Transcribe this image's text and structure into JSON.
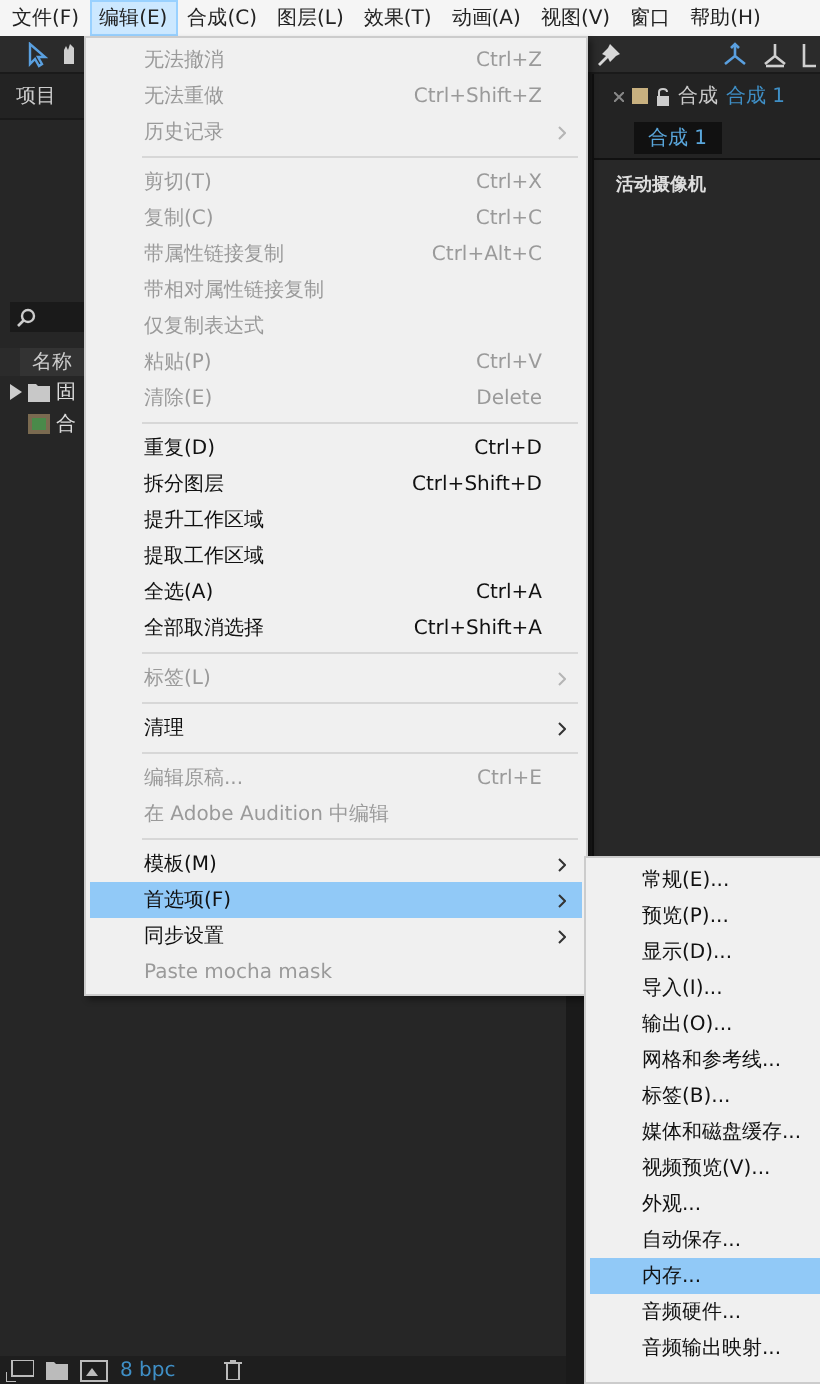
{
  "menubar": [
    {
      "label": "文件(F)",
      "selected": false
    },
    {
      "label": "编辑(E)",
      "selected": true
    },
    {
      "label": "合成(C)",
      "selected": false
    },
    {
      "label": "图层(L)",
      "selected": false
    },
    {
      "label": "效果(T)",
      "selected": false
    },
    {
      "label": "动画(A)",
      "selected": false
    },
    {
      "label": "视图(V)",
      "selected": false
    },
    {
      "label": "窗口",
      "selected": false
    },
    {
      "label": "帮助(H)",
      "selected": false
    }
  ],
  "project_panel": {
    "title": "项目",
    "column": "名称",
    "items": [
      {
        "kind": "folder",
        "label": "固"
      },
      {
        "kind": "composition",
        "label": "合"
      }
    ],
    "bit_depth": "8 bpc"
  },
  "comp_panel": {
    "title": "合成",
    "comp_link": "合成 1",
    "tabs": [
      {
        "label": "合成 1",
        "selected": true
      }
    ],
    "camera": "活动摄像机"
  },
  "edit_menu": [
    {
      "kind": "item",
      "label": "无法撤消",
      "shortcut": "Ctrl+Z",
      "disabled": true,
      "submenu": false,
      "selected": false
    },
    {
      "kind": "item",
      "label": "无法重做",
      "shortcut": "Ctrl+Shift+Z",
      "disabled": true,
      "submenu": false,
      "selected": false
    },
    {
      "kind": "item",
      "label": "历史记录",
      "disabled": true,
      "submenu": true,
      "selected": false
    },
    {
      "kind": "separator"
    },
    {
      "kind": "item",
      "label": "剪切(T)",
      "shortcut": "Ctrl+X",
      "disabled": true,
      "submenu": false,
      "selected": false
    },
    {
      "kind": "item",
      "label": "复制(C)",
      "shortcut": "Ctrl+C",
      "disabled": true,
      "submenu": false,
      "selected": false
    },
    {
      "kind": "item",
      "label": "带属性链接复制",
      "shortcut": "Ctrl+Alt+C",
      "disabled": true,
      "submenu": false,
      "selected": false
    },
    {
      "kind": "item",
      "label": "带相对属性链接复制",
      "disabled": true,
      "submenu": false,
      "selected": false
    },
    {
      "kind": "item",
      "label": "仅复制表达式",
      "disabled": true,
      "submenu": false,
      "selected": false
    },
    {
      "kind": "item",
      "label": "粘贴(P)",
      "shortcut": "Ctrl+V",
      "disabled": true,
      "submenu": false,
      "selected": false
    },
    {
      "kind": "item",
      "label": "清除(E)",
      "shortcut": "Delete",
      "disabled": true,
      "submenu": false,
      "selected": false
    },
    {
      "kind": "separator"
    },
    {
      "kind": "item",
      "label": "重复(D)",
      "shortcut": "Ctrl+D",
      "disabled": false,
      "submenu": false,
      "selected": false
    },
    {
      "kind": "item",
      "label": "拆分图层",
      "shortcut": "Ctrl+Shift+D",
      "disabled": false,
      "submenu": false,
      "selected": false
    },
    {
      "kind": "item",
      "label": "提升工作区域",
      "disabled": false,
      "submenu": false,
      "selected": false
    },
    {
      "kind": "item",
      "label": "提取工作区域",
      "disabled": false,
      "submenu": false,
      "selected": false
    },
    {
      "kind": "item",
      "label": "全选(A)",
      "shortcut": "Ctrl+A",
      "disabled": false,
      "submenu": false,
      "selected": false
    },
    {
      "kind": "item",
      "label": "全部取消选择",
      "shortcut": "Ctrl+Shift+A",
      "disabled": false,
      "submenu": false,
      "selected": false
    },
    {
      "kind": "separator"
    },
    {
      "kind": "item",
      "label": "标签(L)",
      "disabled": true,
      "submenu": true,
      "selected": false
    },
    {
      "kind": "separator"
    },
    {
      "kind": "item",
      "label": "清理",
      "disabled": false,
      "submenu": true,
      "selected": false
    },
    {
      "kind": "separator"
    },
    {
      "kind": "item",
      "label": "编辑原稿...",
      "shortcut": "Ctrl+E",
      "disabled": true,
      "submenu": false,
      "selected": false
    },
    {
      "kind": "item",
      "label": "在 Adobe Audition 中编辑",
      "disabled": true,
      "submenu": false,
      "selected": false
    },
    {
      "kind": "separator"
    },
    {
      "kind": "item",
      "label": "模板(M)",
      "disabled": false,
      "submenu": true,
      "selected": false
    },
    {
      "kind": "item",
      "label": "首选项(F)",
      "disabled": false,
      "submenu": true,
      "selected": true
    },
    {
      "kind": "item",
      "label": "同步设置",
      "disabled": false,
      "submenu": true,
      "selected": false
    },
    {
      "kind": "item",
      "label": "Paste mocha mask",
      "disabled": true,
      "submenu": false,
      "selected": false
    }
  ],
  "preferences_submenu": [
    {
      "label": "常规(E)...",
      "selected": false
    },
    {
      "label": "预览(P)...",
      "selected": false
    },
    {
      "label": "显示(D)...",
      "selected": false
    },
    {
      "label": "导入(I)...",
      "selected": false
    },
    {
      "label": "输出(O)...",
      "selected": false
    },
    {
      "label": "网格和参考线...",
      "selected": false
    },
    {
      "label": "标签(B)...",
      "selected": false
    },
    {
      "label": "媒体和磁盘缓存...",
      "selected": false
    },
    {
      "label": "视频预览(V)...",
      "selected": false
    },
    {
      "label": "外观...",
      "selected": false
    },
    {
      "label": "自动保存...",
      "selected": false
    },
    {
      "label": "内存...",
      "selected": true
    },
    {
      "label": "音频硬件...",
      "selected": false
    },
    {
      "label": "音频输出映射...",
      "selected": false
    }
  ]
}
